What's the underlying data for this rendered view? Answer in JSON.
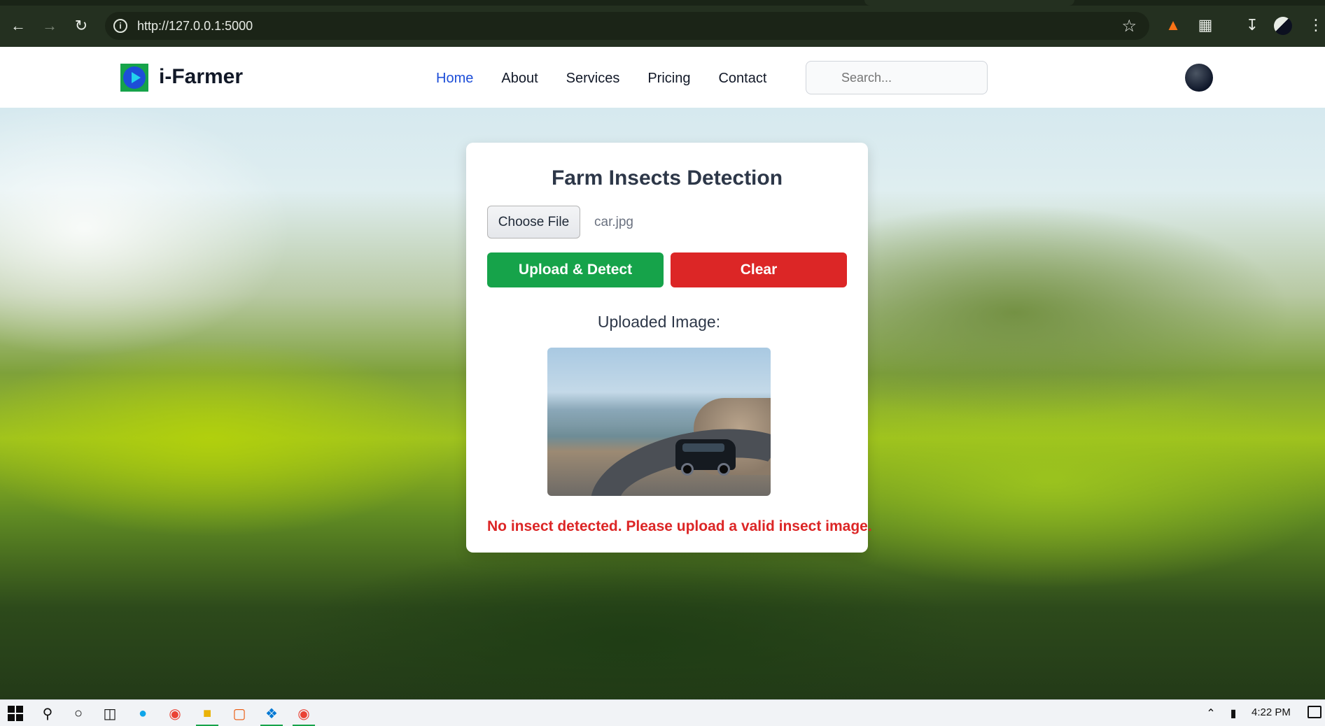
{
  "browser": {
    "url": "http://127.0.0.1:5000",
    "back_icon": "back-arrow-icon",
    "forward_icon": "forward-arrow-icon",
    "reload_icon": "reload-icon",
    "site_info_icon": "info-icon",
    "bookmark_icon": "star-icon",
    "extensions": [
      "metamask-fox-icon",
      "puzzle-extensions-icon",
      "download-icon",
      "profile-avatar-icon",
      "kebab-menu-icon"
    ]
  },
  "header": {
    "brand": "i-Farmer",
    "logo_icon": "play-logo-icon",
    "nav": [
      {
        "label": "Home",
        "active": true
      },
      {
        "label": "About",
        "active": false
      },
      {
        "label": "Services",
        "active": false
      },
      {
        "label": "Pricing",
        "active": false
      },
      {
        "label": "Contact",
        "active": false
      }
    ],
    "search_placeholder": "Search...",
    "avatar_icon": "user-avatar-icon"
  },
  "card": {
    "title": "Farm Insects Detection",
    "choose_file_label": "Choose File",
    "file_name": "car.jpg",
    "upload_button": "Upload & Detect",
    "clear_button": "Clear",
    "uploaded_label": "Uploaded Image:",
    "error_message": "No insect detected. Please upload a valid insect image."
  },
  "colors": {
    "accent_blue": "#1d4ed8",
    "upload_green": "#16a34a",
    "clear_red": "#dc2626",
    "error_red": "#dc2626"
  },
  "taskbar": {
    "icons": [
      "windows-start-icon",
      "search-icon",
      "cortana-icon",
      "task-view-icon",
      "edge-icon",
      "chrome-icon",
      "file-explorer-icon",
      "office-icon",
      "vscode-icon",
      "chrome-active-icon"
    ],
    "time": "4:22 PM"
  }
}
